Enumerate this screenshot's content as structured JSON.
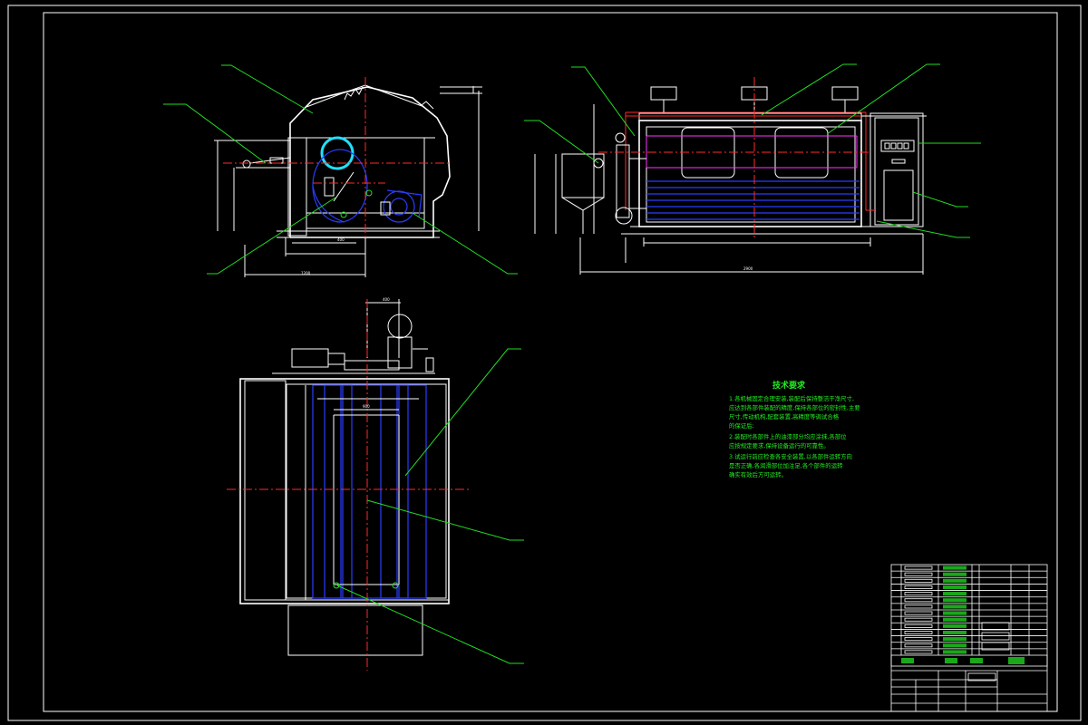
{
  "drawing": {
    "technical_requirements_title": "技术要求",
    "technical_requirements_lines": [
      "1.各机械固定合理安装,装配后保持整洁干净尺寸,",
      "应达到各部件装配的精度,保持各部位的密封性,主要",
      "尺寸,传动机构,配套装置,高精度等调试合格",
      "的保证后;",
      "2.装配时各部件上的油漆部分均应涂抹,各部位",
      "应按规定要求,保持设备运行的可靠性。",
      "3.试运行前应检查各安全装置,以各部件运转方向",
      "是否正确,各润滑部位加注足,各个部件的运转",
      "确实有效后方可运转。"
    ],
    "colors": {
      "background": "#000000",
      "frame": "#ffffff",
      "centerline": "#ff2a2a",
      "drum": "#2a3cff",
      "leader": "#22dd22",
      "text": "#22ee22",
      "accent_pipe": "#22e0ff",
      "magenta": "#ff33ff"
    }
  }
}
